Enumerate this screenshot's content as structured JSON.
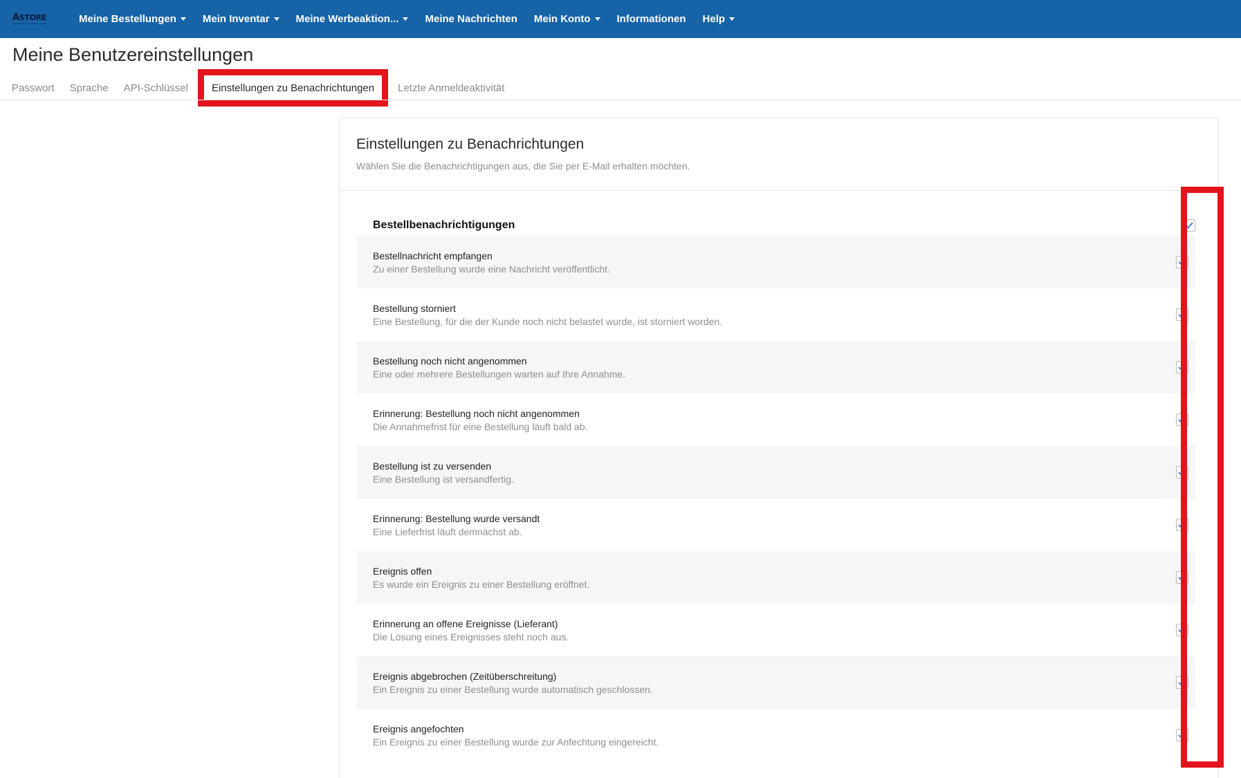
{
  "nav": {
    "logo": {
      "a": "A",
      "rest": "STORE"
    },
    "items": [
      {
        "label": "Meine Bestellungen",
        "dropdown": true
      },
      {
        "label": "Mein Inventar",
        "dropdown": true
      },
      {
        "label": "Meine Werbeaktion...",
        "dropdown": true
      },
      {
        "label": "Meine Nachrichten",
        "dropdown": false
      },
      {
        "label": "Mein Konto",
        "dropdown": true
      },
      {
        "label": "Informationen",
        "dropdown": false
      },
      {
        "label": "Help",
        "dropdown": true
      }
    ]
  },
  "page": {
    "title": "Meine Benutzereinstellungen",
    "tabs": [
      {
        "label": "Passwort"
      },
      {
        "label": "Sprache"
      },
      {
        "label": "API-Schlüssel"
      },
      {
        "label": "Einstellungen zu Benachrichtungen",
        "active": true
      },
      {
        "label": "Letzte Anmeldeaktivität"
      }
    ]
  },
  "card": {
    "title": "Einstellungen zu Benachrichtungen",
    "subtitle": "Wählen Sie die Benachrichtigungen aus, die Sie per E-Mail erhalten möchten.",
    "section_title": "Bestellbenachrichtigungen",
    "section_checked": true,
    "notifications": [
      {
        "title": "Bestellnachricht empfangen",
        "desc": "Zu einer Bestellung wurde eine Nachricht veröffentlicht.",
        "checked": true
      },
      {
        "title": "Bestellung storniert",
        "desc": "Eine Bestellung, für die der Kunde noch nicht belastet wurde, ist storniert worden.",
        "checked": true
      },
      {
        "title": "Bestellung noch nicht angenommen",
        "desc": "Eine oder mehrere Bestellungen warten auf Ihre Annahme.",
        "checked": true
      },
      {
        "title": "Erinnerung: Bestellung noch nicht angenommen",
        "desc": "Die Annahmefrist für eine Bestellung läuft bald ab.",
        "checked": true
      },
      {
        "title": "Bestellung ist zu versenden",
        "desc": "Eine Bestellung ist versandfertig.",
        "checked": true
      },
      {
        "title": "Erinnerung: Bestellung wurde versandt",
        "desc": "Eine Lieferfrist läuft demnächst ab.",
        "checked": true
      },
      {
        "title": "Ereignis offen",
        "desc": "Es wurde ein Ereignis zu einer Bestellung eröffnet.",
        "checked": true
      },
      {
        "title": "Erinnerung an offene Ereignisse (Lieferant)",
        "desc": "Die Lösung eines Ereignisses steht noch aus.",
        "checked": true
      },
      {
        "title": "Ereignis abgebrochen (Zeitüberschreitung)",
        "desc": "Ein Ereignis zu einer Bestellung wurde automatisch geschlossen.",
        "checked": true
      },
      {
        "title": "Ereignis angefochten",
        "desc": "Ein Ereignis zu einer Bestellung wurde zur Anfechtung eingereicht.",
        "checked": true
      }
    ]
  },
  "colors": {
    "nav_bg": "#1663a8",
    "highlight_red": "#e3141c",
    "check_blue": "#2a7fd4",
    "row_shade": "#f6f6f6"
  }
}
